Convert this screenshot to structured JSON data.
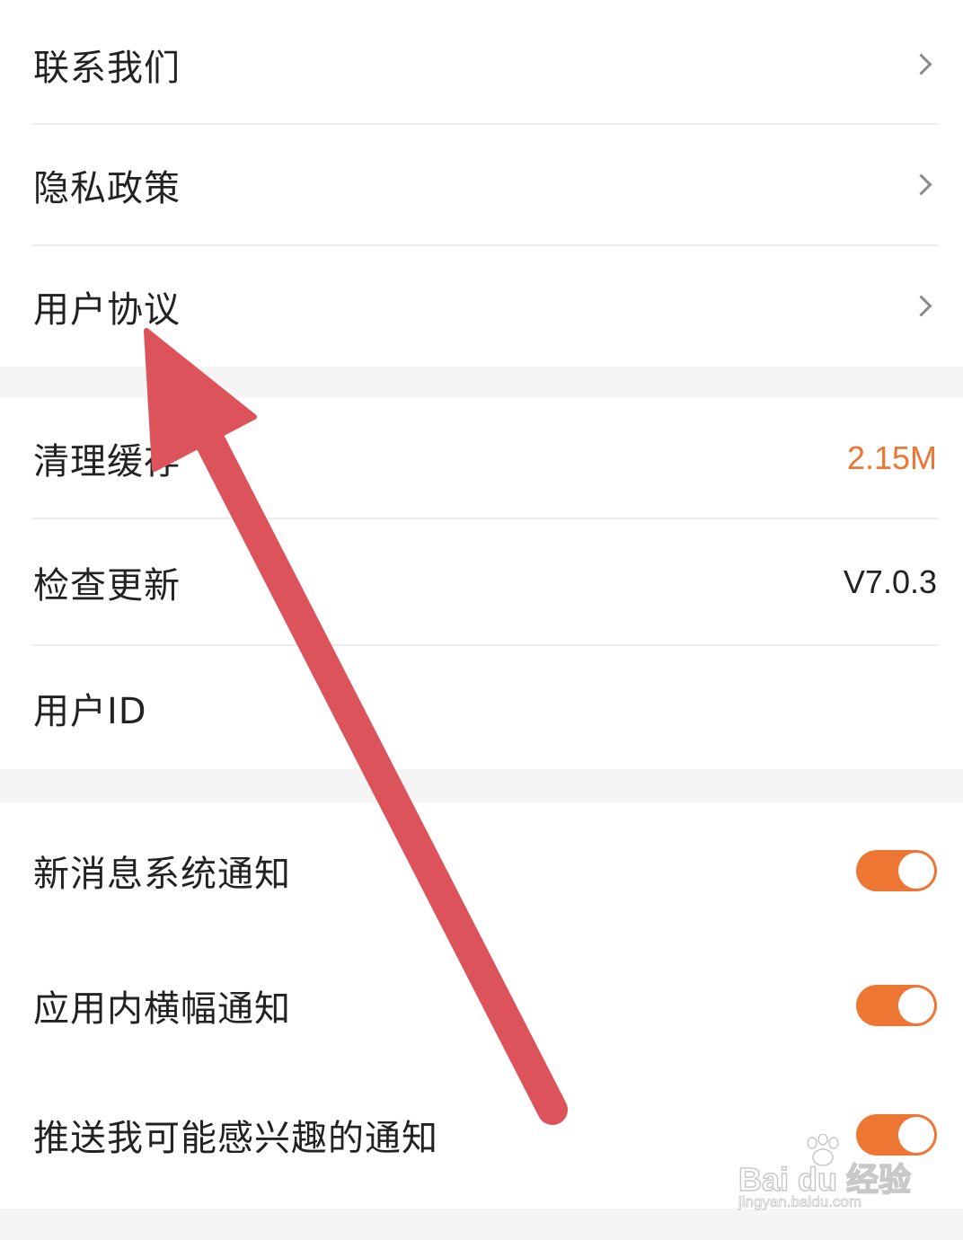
{
  "group_about": {
    "items": [
      {
        "label": "联系我们",
        "icon": "chevron-right-icon"
      },
      {
        "label": "隐私政策",
        "icon": "chevron-right-icon"
      },
      {
        "label": "用户协议",
        "icon": "chevron-right-icon"
      }
    ]
  },
  "group_app": {
    "clear_cache": {
      "label": "清理缓存",
      "value": "2.15M"
    },
    "check_update": {
      "label": "检查更新",
      "value": "V7.0.3"
    },
    "user_id": {
      "label": "用户ID"
    }
  },
  "group_notifications": {
    "items": [
      {
        "label": "新消息系统通知",
        "enabled": true
      },
      {
        "label": "应用内横幅通知",
        "enabled": true
      },
      {
        "label": "推送我可能感兴趣的通知",
        "enabled": true
      }
    ]
  },
  "annotation": {
    "icon": "red-arrow-icon",
    "color": "#dc535b"
  },
  "watermark": {
    "main": "Bai du 经验",
    "sub": "jingyan.baidu.com"
  },
  "colors": {
    "accent": "#ed7633",
    "background": "#f5f5f5",
    "card": "#ffffff"
  }
}
